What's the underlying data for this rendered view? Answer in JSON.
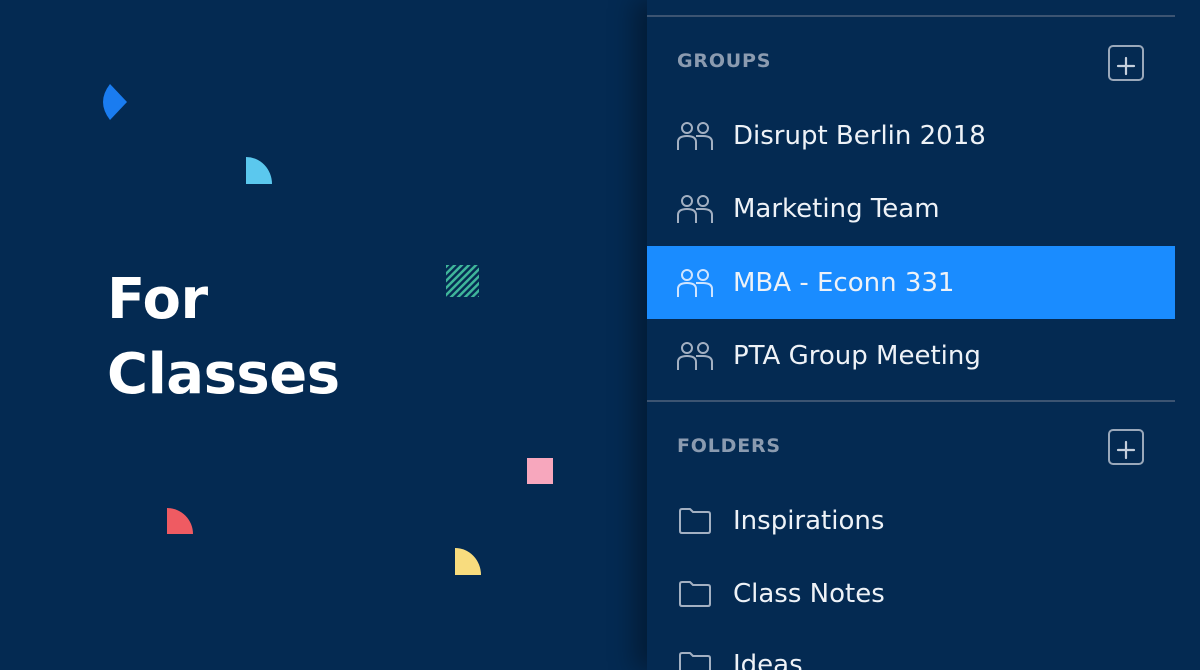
{
  "hero": {
    "line1": "For",
    "line2": "Classes"
  },
  "sidebar": {
    "groups": {
      "title": "GROUPS",
      "items": [
        {
          "label": "Disrupt Berlin 2018",
          "icon": "group-icon"
        },
        {
          "label": "Marketing Team",
          "icon": "group-icon"
        },
        {
          "label": "MBA - Econn 331",
          "icon": "group-icon",
          "selected": true
        },
        {
          "label": "PTA Group Meeting",
          "icon": "group-icon"
        }
      ]
    },
    "folders": {
      "title": "FOLDERS",
      "items": [
        {
          "label": "Inspirations",
          "icon": "folder-icon"
        },
        {
          "label": "Class Notes",
          "icon": "folder-icon"
        },
        {
          "label": "Ideas",
          "icon": "folder-icon"
        }
      ]
    }
  },
  "colors": {
    "background": "#042a52",
    "selected": "#1a8cff",
    "confetti_blue": "#1a7cf0",
    "confetti_cyan": "#5bc8ee",
    "confetti_green": "#3fb59a",
    "confetti_pink": "#f7a7bd",
    "confetti_red": "#ef5b62",
    "confetti_yellow": "#f8dc7e"
  }
}
